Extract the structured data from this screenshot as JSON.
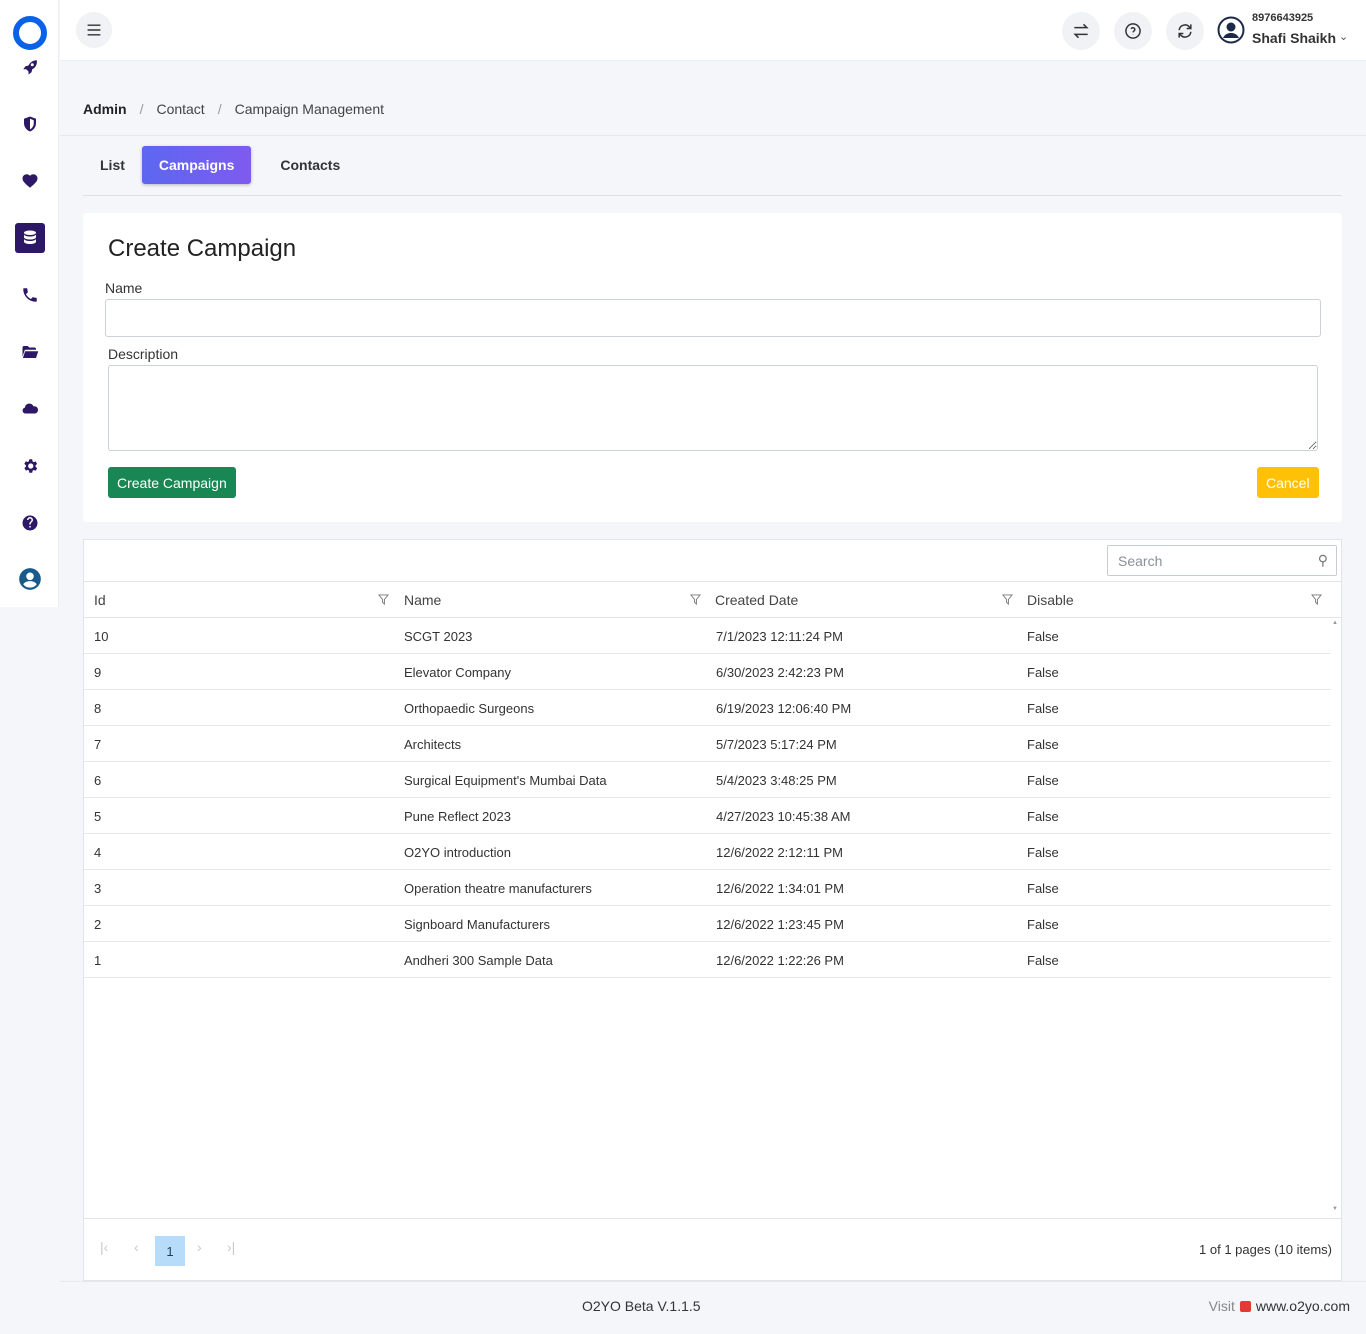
{
  "sidebar": {
    "items": [
      {
        "name": "rocket-icon"
      },
      {
        "name": "shield-icon"
      },
      {
        "name": "heart-icon"
      },
      {
        "name": "database-icon",
        "active": true
      },
      {
        "name": "phone-icon"
      },
      {
        "name": "folder-open-icon"
      },
      {
        "name": "cloud-icon"
      },
      {
        "name": "gear-icon"
      },
      {
        "name": "question-icon"
      },
      {
        "name": "user-circle-icon"
      }
    ]
  },
  "header": {
    "phone": "8976643925",
    "user_name": "Shafi Shaikh",
    "icons": [
      "transfer-icon",
      "help-icon",
      "refresh-icon"
    ]
  },
  "breadcrumb": {
    "items": [
      "Admin",
      "Contact",
      "Campaign Management"
    ],
    "separator": "/"
  },
  "tabs": [
    {
      "label": "List"
    },
    {
      "label": "Campaigns",
      "active": true
    },
    {
      "label": "Contacts"
    }
  ],
  "create_form": {
    "title": "Create Campaign",
    "name_label": "Name",
    "name_value": "",
    "description_label": "Description",
    "description_value": "",
    "create_button": "Create Campaign",
    "cancel_button": "Cancel"
  },
  "grid": {
    "search_placeholder": "Search",
    "columns": [
      "Id",
      "Name",
      "Created Date",
      "Disable"
    ],
    "rows": [
      [
        "10",
        "SCGT 2023",
        "7/1/2023 12:11:24 PM",
        "False"
      ],
      [
        "9",
        "Elevator Company",
        "6/30/2023 2:42:23 PM",
        "False"
      ],
      [
        "8",
        "Orthopaedic Surgeons",
        "6/19/2023 12:06:40 PM",
        "False"
      ],
      [
        "7",
        "Architects",
        "5/7/2023 5:17:24 PM",
        "False"
      ],
      [
        "6",
        "Surgical Equipment's Mumbai Data",
        "5/4/2023 3:48:25 PM",
        "False"
      ],
      [
        "5",
        "Pune Reflect 2023",
        "4/27/2023 10:45:38 AM",
        "False"
      ],
      [
        "4",
        "O2YO introduction",
        "12/6/2022 2:12:11 PM",
        "False"
      ],
      [
        "3",
        "Operation theatre manufacturers",
        "12/6/2022 1:34:01 PM",
        "False"
      ],
      [
        "2",
        "Signboard Manufacturers",
        "12/6/2022 1:23:45 PM",
        "False"
      ],
      [
        "1",
        "Andheri 300 Sample Data",
        "12/6/2022 1:22:26 PM",
        "False"
      ]
    ],
    "pager": {
      "current_page": "1",
      "info": "1 of 1 pages (10 items)"
    }
  },
  "footer": {
    "version": "O2YO Beta V.1.1.5",
    "visit_label": "Visit",
    "visit_url": "www.o2yo.com"
  },
  "colors": {
    "sidebar_icon": "#2d1866",
    "logo": "#0b62e8",
    "tab_active_start": "#5c67f0",
    "tab_active_end": "#7e5bef",
    "create_button": "#198754",
    "cancel_button": "#ffc107",
    "pager_active": "#b6dcf9"
  }
}
